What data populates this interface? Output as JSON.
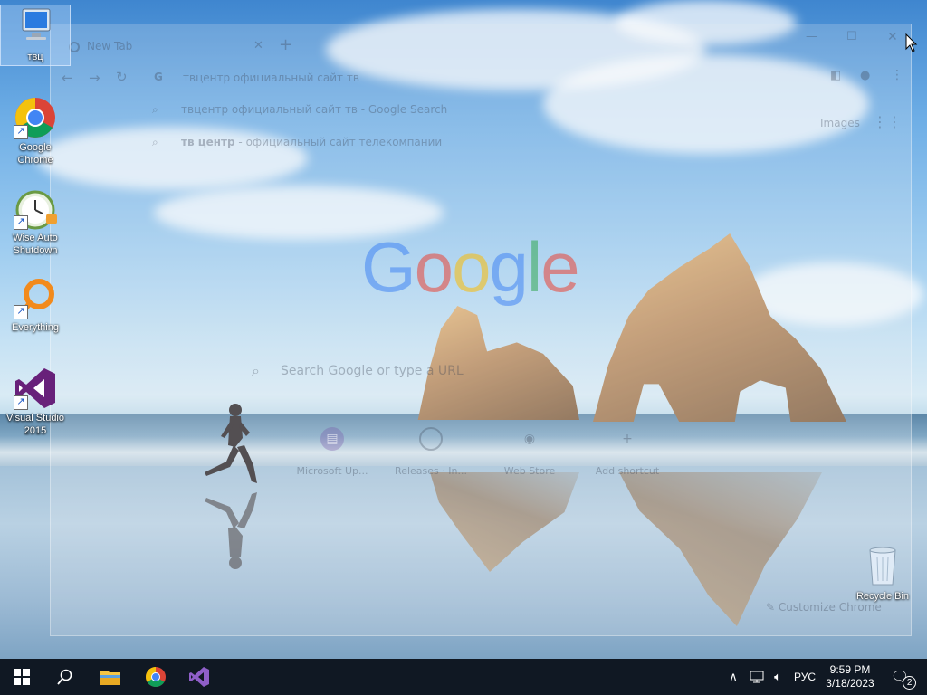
{
  "desktop": {
    "icons": [
      {
        "label": "твц"
      },
      {
        "label": "Google Chrome"
      },
      {
        "label": "Wise Auto Shutdown"
      },
      {
        "label": "Everything"
      },
      {
        "label": "Visual Studio 2015"
      },
      {
        "label": "Recycle Bin"
      }
    ]
  },
  "chrome": {
    "tab_title": "New Tab",
    "omnibox_text": "твцентр официальный сайт тв",
    "suggestions": [
      {
        "text": "твцентр официальный сайт тв - Google Search"
      },
      {
        "bold": "тв центр",
        "rest": " - официальный сайт телекомпании"
      }
    ],
    "images_link": "Images",
    "search_placeholder": "Search Google or type a URL",
    "shortcuts": [
      {
        "label": "Microsoft Up..."
      },
      {
        "label": "Releases · In..."
      },
      {
        "label": "Web Store"
      },
      {
        "label": "Add shortcut"
      }
    ],
    "customize_label": "Customize Chrome"
  },
  "taskbar": {
    "language": "РУС",
    "time": "9:59 PM",
    "date": "3/18/2023",
    "notification_count": "2"
  },
  "colors": {
    "taskbar_bg": "#101823",
    "google_blue": "#4285f4",
    "google_red": "#ea4335",
    "google_yellow": "#fbbc05",
    "google_green": "#34a853",
    "vs_purple": "#68217a"
  }
}
